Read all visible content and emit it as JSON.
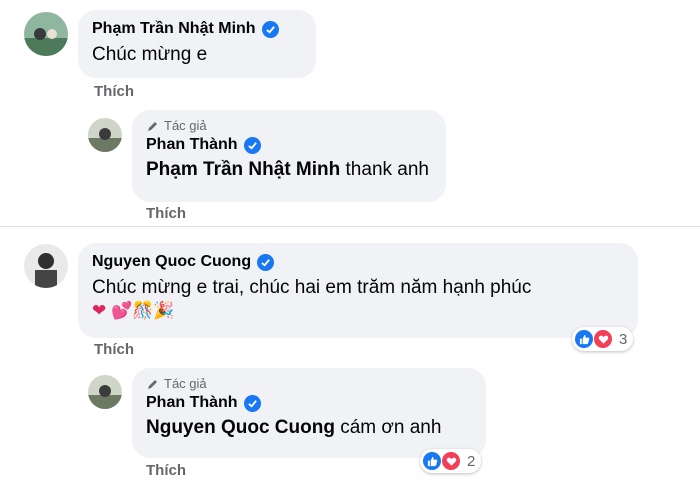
{
  "comments": [
    {
      "author": "Phạm Trần Nhật Minh",
      "text": "Chúc mừng e",
      "like_label": "Thích",
      "reply": {
        "badge": "Tác giả",
        "author": "Phan Thành",
        "mention": "Phạm Trần Nhật Minh",
        "text": "thank anh",
        "like_label": "Thích"
      }
    },
    {
      "author": "Nguyen Quoc Cuong",
      "text": "Chúc mừng e trai, chúc hai em trăm năm hạnh phúc",
      "emojis": "❤ 💕🎊🎉",
      "reaction_count": "3",
      "like_label": "Thích",
      "reply": {
        "badge": "Tác giả",
        "author": "Phan Thành",
        "mention": "Nguyen Quoc Cuong",
        "text": "cám ơn anh",
        "reaction_count": "2",
        "like_label": "Thích"
      }
    }
  ],
  "colors": {
    "verified": "#1877f2",
    "love": "#f33e58",
    "bubble": "#f0f2f5"
  }
}
